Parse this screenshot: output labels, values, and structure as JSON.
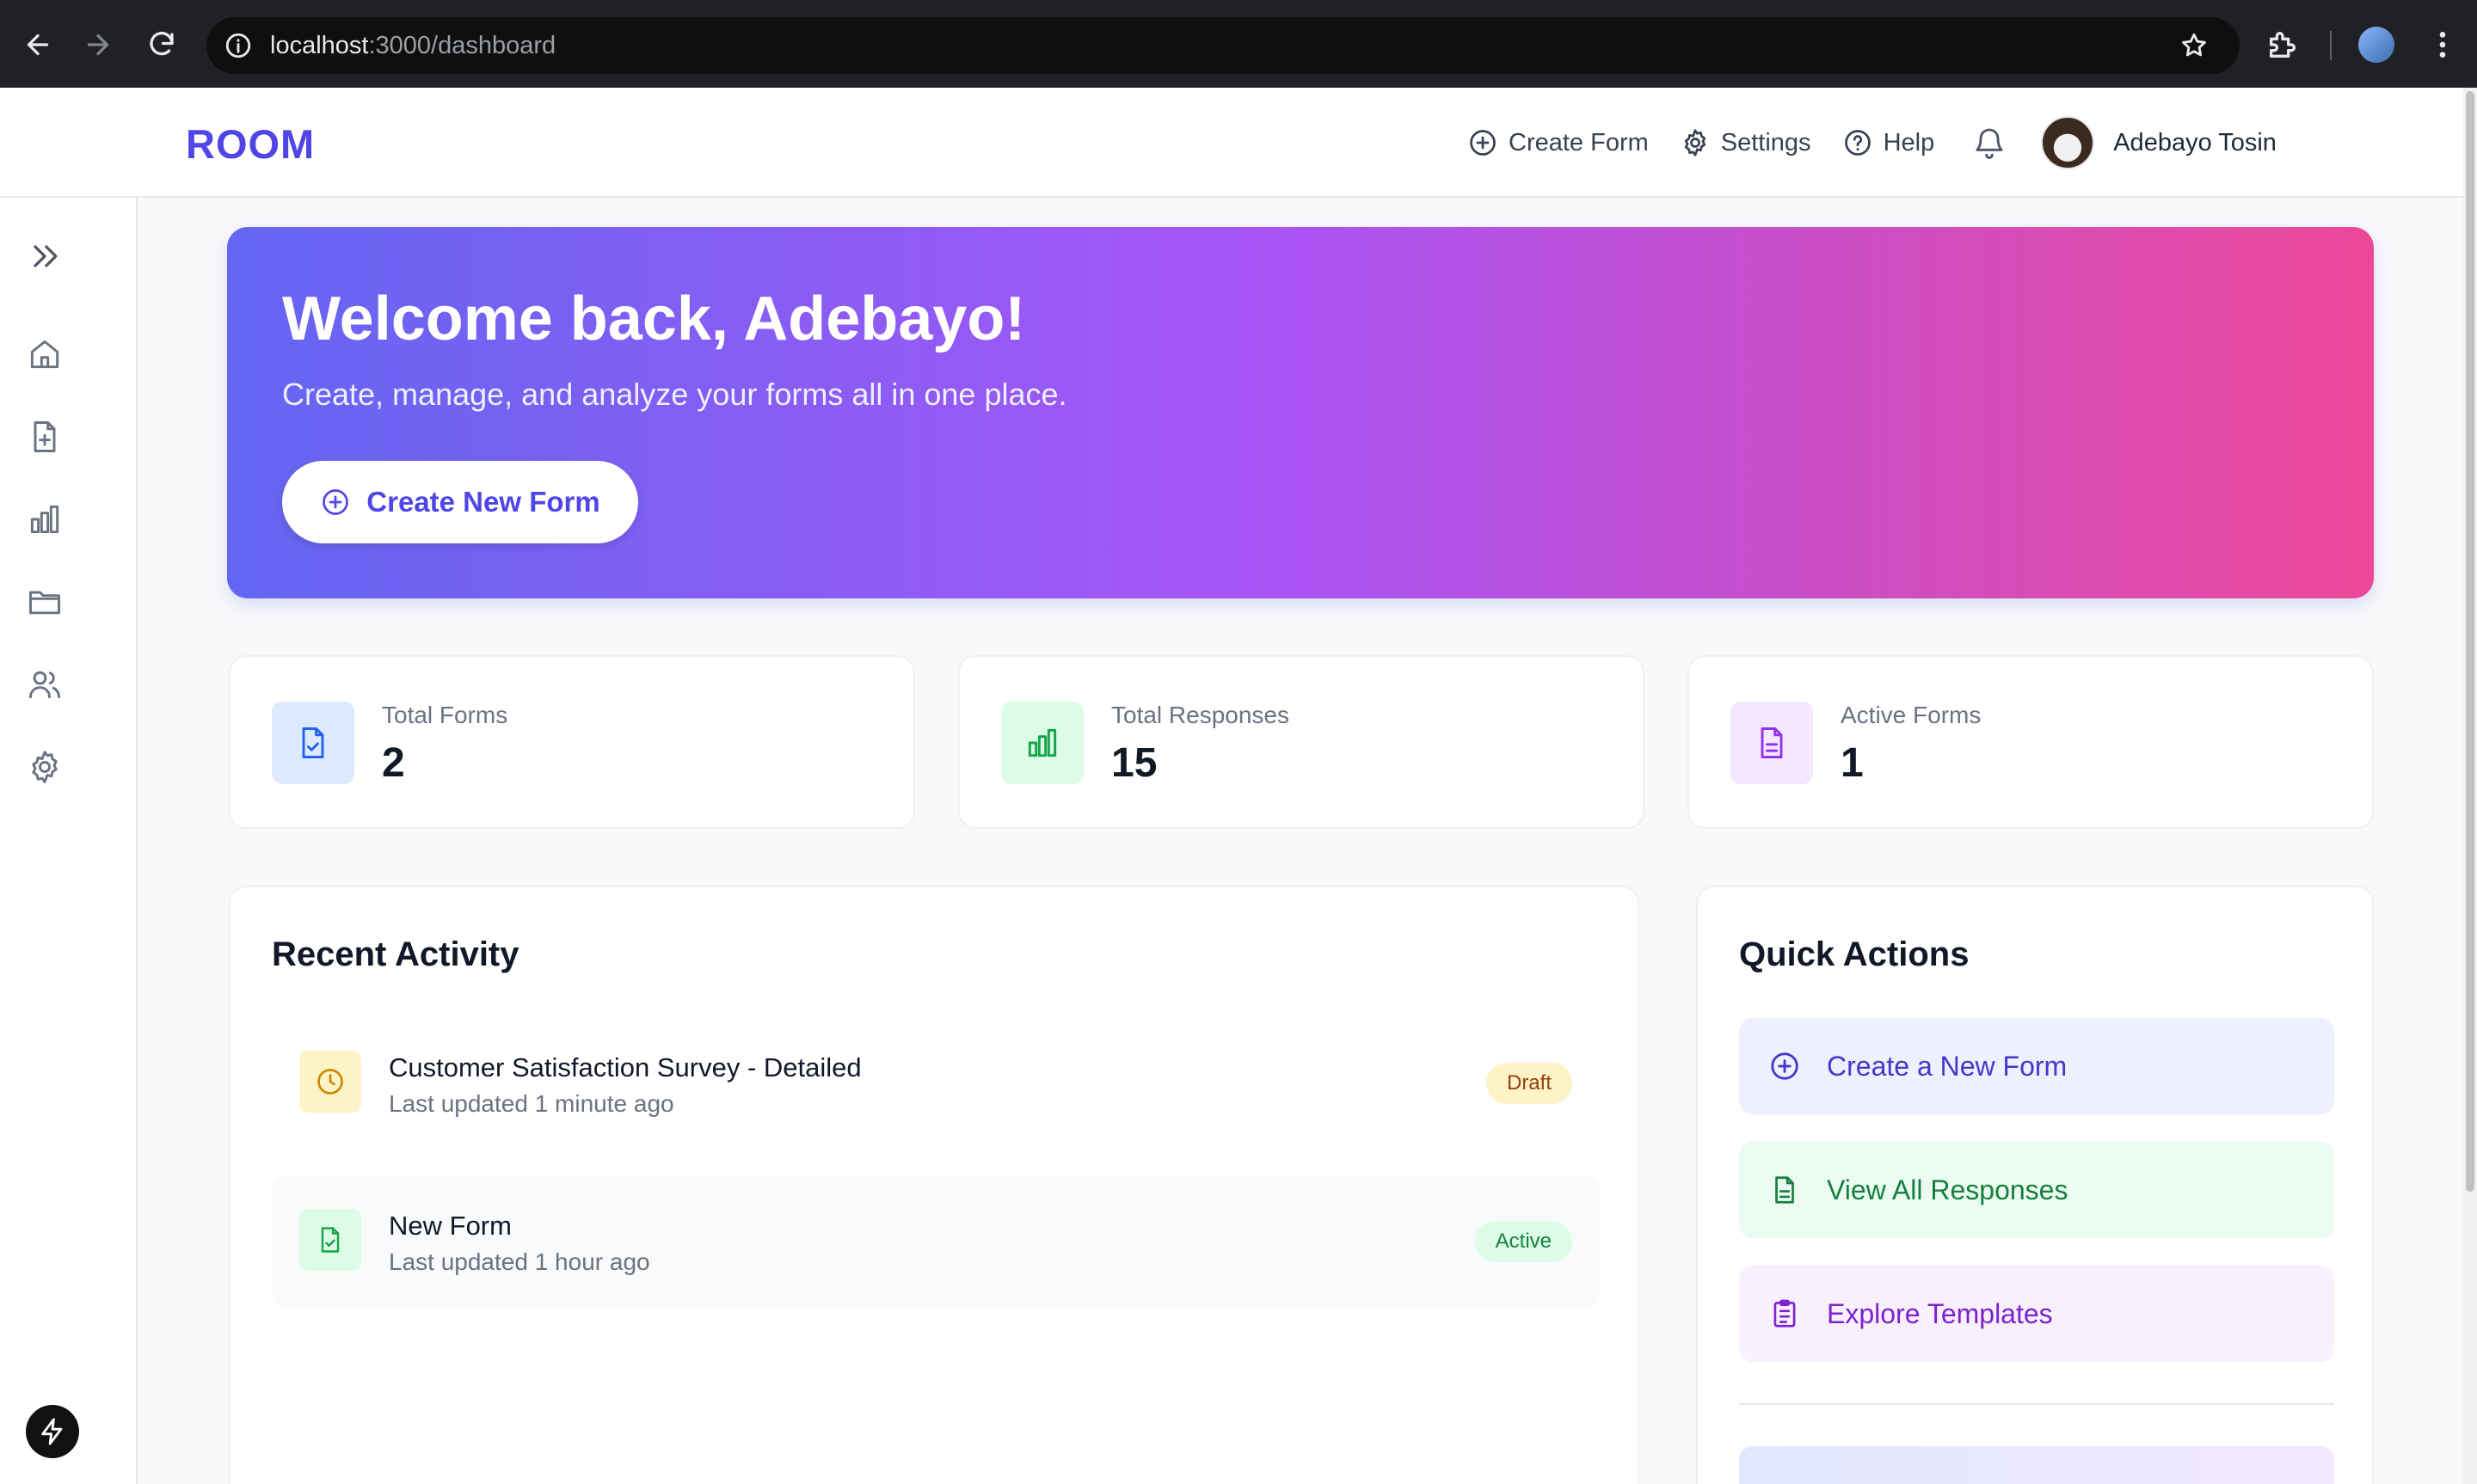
{
  "browser": {
    "url_host": "localhost",
    "url_path": ":3000/dashboard"
  },
  "header": {
    "brand": "ROOM",
    "nav": {
      "create_form": "Create Form",
      "settings": "Settings",
      "help": "Help"
    },
    "user_name": "Adebayo Tosin"
  },
  "sidebar": {
    "items": [
      "expand-icon",
      "home-icon",
      "file-plus-icon",
      "bar-chart-icon",
      "folder-icon",
      "users-icon",
      "gear-icon"
    ]
  },
  "hero": {
    "title": "Welcome back, Adebayo!",
    "subtitle": "Create, manage, and analyze your forms all in one place.",
    "cta": "Create New Form"
  },
  "stats": [
    {
      "label": "Total Forms",
      "value": "2",
      "icon": "file-check-icon",
      "color": "#2563eb",
      "bg": "#dbeafe"
    },
    {
      "label": "Total Responses",
      "value": "15",
      "icon": "bar-chart-icon",
      "color": "#16a34a",
      "bg": "#dcfce7"
    },
    {
      "label": "Active Forms",
      "value": "1",
      "icon": "file-text-icon",
      "color": "#9333ea",
      "bg": "#f3e8ff"
    }
  ],
  "recent_activity": {
    "title": "Recent Activity",
    "items": [
      {
        "title": "Customer Satisfaction Survey - Detailed",
        "subtitle": "Last updated 1 minute ago",
        "status": "Draft"
      },
      {
        "title": "New Form",
        "subtitle": "Last updated 1 hour ago",
        "status": "Active"
      }
    ]
  },
  "quick_actions": {
    "title": "Quick Actions",
    "items": [
      {
        "label": "Create a New Form",
        "color": "#4338ca",
        "bg": "#eef0fd"
      },
      {
        "label": "View All Responses",
        "color": "#15803d",
        "bg": "#ecfbf1"
      },
      {
        "label": "Explore Templates",
        "color": "#7e22ce",
        "bg": "#f8f0fd"
      }
    ]
  },
  "colors": {
    "brand": "#4f46e5",
    "hero_start": "#6366f1",
    "hero_mid": "#a855f7",
    "hero_end": "#ec4899",
    "draft_bg": "#fef3c7",
    "draft_text": "#92400e",
    "active_bg": "#dcfce7",
    "active_text": "#15803d"
  }
}
